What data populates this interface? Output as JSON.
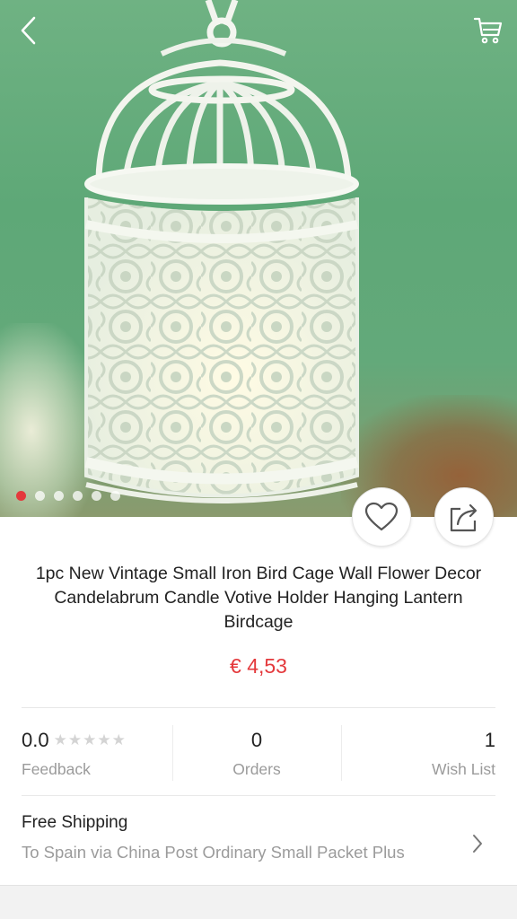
{
  "gallery": {
    "image_count": 6,
    "active_index": 0,
    "accent": "#e4393c"
  },
  "icons": {
    "back": "chevron-left-icon",
    "cart": "cart-icon",
    "wish": "heart-icon",
    "share": "share-icon",
    "arrow": "chevron-right-icon"
  },
  "product": {
    "title": "1pc New Vintage Small Iron Bird Cage Wall Flower Decor Candelabrum Candle Votive Holder Hanging Lantern Birdcage",
    "price": "€ 4,53"
  },
  "stats": {
    "rating": "0.0",
    "stars": [
      "★",
      "★",
      "★",
      "★",
      "★"
    ],
    "feedback_label": "Feedback",
    "orders_count": "0",
    "orders_label": "Orders",
    "wish_count": "1",
    "wish_label": "Wish List"
  },
  "shipping": {
    "title": "Free Shipping",
    "detail": "To Spain via China Post Ordinary Small Packet Plus"
  }
}
